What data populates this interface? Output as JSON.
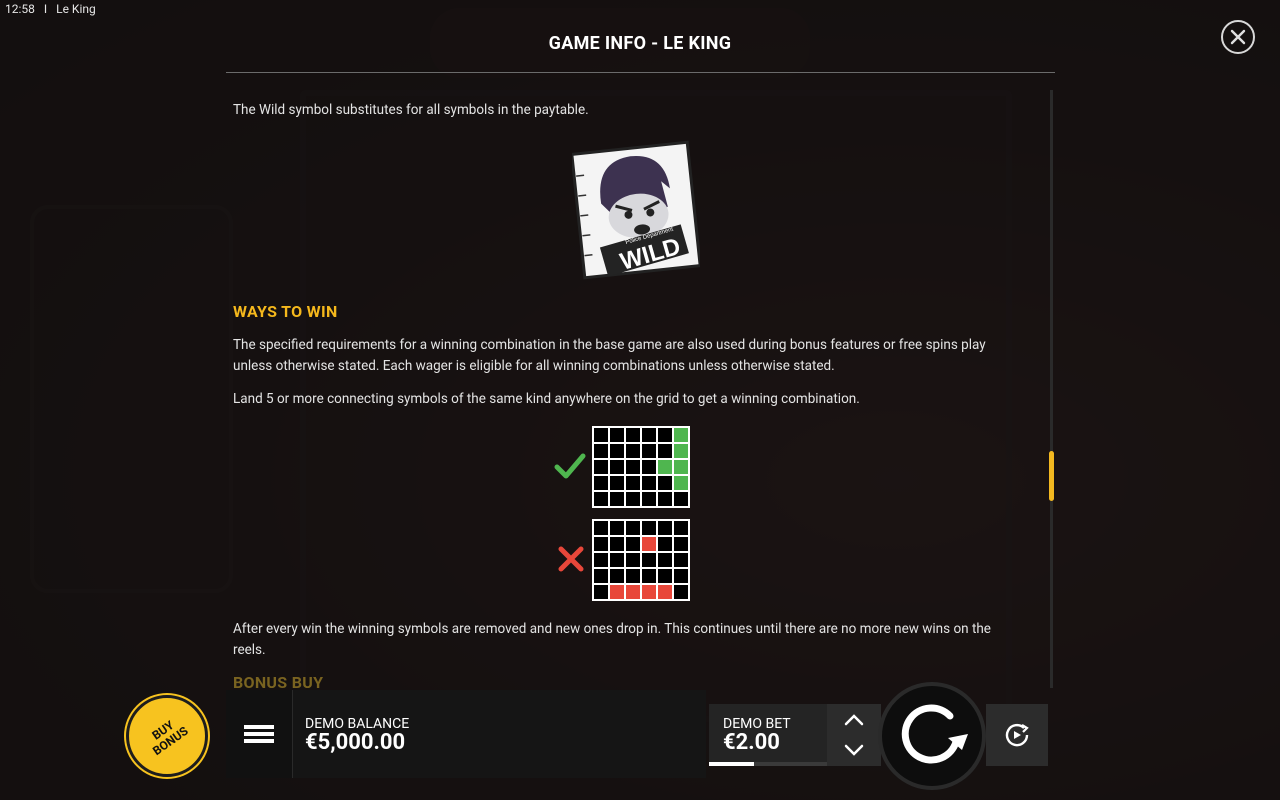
{
  "status_bar": {
    "time": "12:58",
    "separator": "I",
    "app_name": "Le King"
  },
  "dialog": {
    "title": "GAME INFO - LE KING",
    "close_label": "close",
    "wild_text": "The Wild symbol substitutes for all symbols in the paytable.",
    "wild_image": {
      "top_text": "Police Department",
      "word": "WILD"
    },
    "ways_heading": "WAYS TO WIN",
    "ways_p1": "The specified requirements for a winning combination in the base game are also used during bonus features or free spins play unless otherwise stated. Each wager is eligible for all winning combinations unless otherwise stated.",
    "ways_p2": "Land 5 or more connecting symbols of the same kind anywhere on the grid to get a winning combination.",
    "example_valid": {
      "icon": "check-icon",
      "color": "#4fb64f"
    },
    "example_invalid": {
      "icon": "cross-icon",
      "color": "#e8473a"
    },
    "cascade_text": "After every win the winning symbols are removed and new ones drop in. This continues until there are no more new wins on the reels.",
    "next_heading": "BONUS BUY"
  },
  "bottom_bar": {
    "buy_bonus_label": "BUY BONUS",
    "balance_label": "DEMO BALANCE",
    "balance_value": "€5,000.00",
    "bet_label": "DEMO BET",
    "bet_value": "€2.00"
  },
  "colors": {
    "accent": "#f5b81c",
    "buy_bonus": "#f7c31f"
  }
}
